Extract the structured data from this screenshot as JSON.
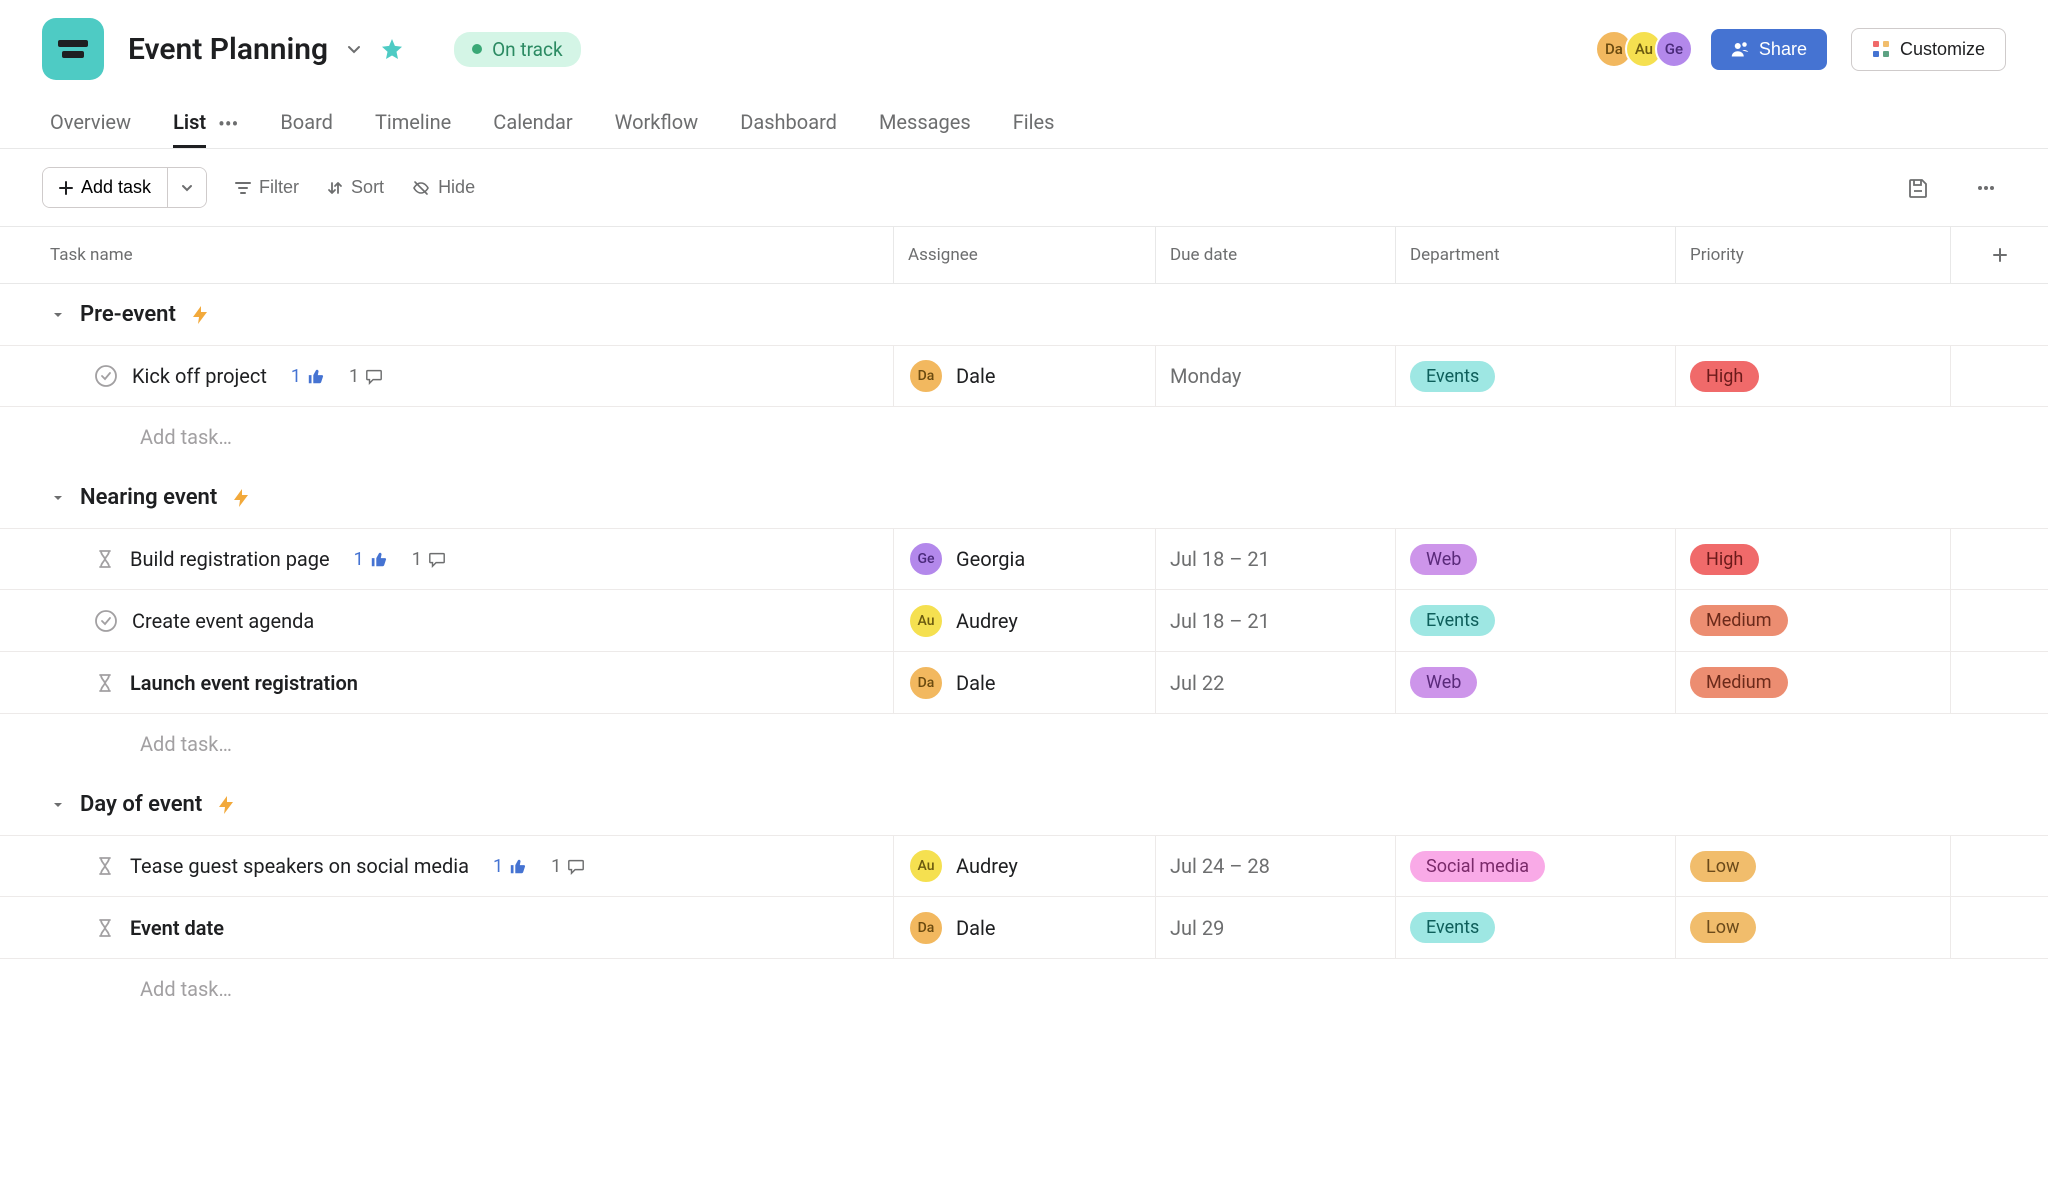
{
  "header": {
    "title": "Event Planning",
    "status": "On track",
    "share_label": "Share",
    "customize_label": "Customize",
    "avatars": [
      "Da",
      "Au",
      "Ge"
    ]
  },
  "tabs": [
    "Overview",
    "List",
    "Board",
    "Timeline",
    "Calendar",
    "Workflow",
    "Dashboard",
    "Messages",
    "Files"
  ],
  "active_tab": "List",
  "toolbar": {
    "add_task": "Add task",
    "filter": "Filter",
    "sort": "Sort",
    "hide": "Hide"
  },
  "columns": {
    "task": "Task name",
    "assignee": "Assignee",
    "due": "Due date",
    "dept": "Department",
    "priority": "Priority"
  },
  "add_task_placeholder": "Add task…",
  "sections": [
    {
      "name": "Pre-event",
      "tasks": [
        {
          "status": "circle",
          "name": "Kick off project",
          "bold": false,
          "likes": "1",
          "comments": "1",
          "assignee": "Dale",
          "assignee_initials": "Da",
          "assignee_class": "da",
          "due": "Monday",
          "dept": "Events",
          "dept_class": "events",
          "priority": "High",
          "priority_class": "high"
        }
      ]
    },
    {
      "name": "Nearing event",
      "tasks": [
        {
          "status": "hourglass",
          "name": "Build registration page",
          "bold": false,
          "likes": "1",
          "comments": "1",
          "assignee": "Georgia",
          "assignee_initials": "Ge",
          "assignee_class": "ge",
          "due": "Jul 18 – 21",
          "dept": "Web",
          "dept_class": "web",
          "priority": "High",
          "priority_class": "high"
        },
        {
          "status": "circle",
          "name": "Create event agenda",
          "bold": false,
          "assignee": "Audrey",
          "assignee_initials": "Au",
          "assignee_class": "au",
          "due": "Jul 18 – 21",
          "dept": "Events",
          "dept_class": "events",
          "priority": "Medium",
          "priority_class": "medium"
        },
        {
          "status": "hourglass",
          "name": "Launch event registration",
          "bold": true,
          "assignee": "Dale",
          "assignee_initials": "Da",
          "assignee_class": "da",
          "due": "Jul 22",
          "dept": "Web",
          "dept_class": "web",
          "priority": "Medium",
          "priority_class": "medium"
        }
      ]
    },
    {
      "name": "Day of event",
      "tasks": [
        {
          "status": "hourglass",
          "name": "Tease guest speakers on social media",
          "bold": false,
          "likes": "1",
          "comments": "1",
          "assignee": "Audrey",
          "assignee_initials": "Au",
          "assignee_class": "au",
          "due": "Jul 24 – 28",
          "dept": "Social media",
          "dept_class": "social",
          "priority": "Low",
          "priority_class": "low"
        },
        {
          "status": "hourglass",
          "name": "Event date",
          "bold": true,
          "assignee": "Dale",
          "assignee_initials": "Da",
          "assignee_class": "da",
          "due": "Jul 29",
          "dept": "Events",
          "dept_class": "events",
          "priority": "Low",
          "priority_class": "low"
        }
      ]
    }
  ]
}
